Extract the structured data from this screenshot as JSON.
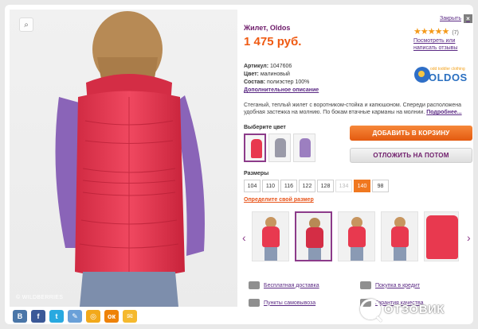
{
  "product": {
    "title": "Жилет, Oldos",
    "price": "1 475 руб.",
    "close_label": "Закрыть",
    "close_icon": "×",
    "rating_stars": "★★★★★",
    "rating_count": "(7)",
    "review_link_1": "Посмотреть или",
    "review_link_2": "написать отзывы"
  },
  "attributes": {
    "article_label": "Артикул:",
    "article_value": "1047606",
    "color_label": "Цвет:",
    "color_value": "малиновый",
    "composition_label": "Состав:",
    "composition_value": "полиэстер 100%",
    "more_link": "Дополнительное описание"
  },
  "brand": {
    "logo": "OLDOS",
    "tagline": "odd toddler clothing"
  },
  "description": {
    "text": "Стеганый, теплый жилет с воротником-стойка и капюшоном. Спереди расположена удобная застежка на молнию. По бокам втачные карманы на молнии.",
    "more": "Подробнее..."
  },
  "colors": {
    "label": "Выберите цвет",
    "swatches": [
      {
        "color": "#e8394f",
        "selected": true
      },
      {
        "color": "#9a9aa8",
        "selected": false
      },
      {
        "color": "#9c7fc0",
        "selected": false
      }
    ]
  },
  "actions": {
    "add_to_cart": "ДОБАВИТЬ В КОРЗИНУ",
    "save_later": "ОТЛОЖИТЬ НА ПОТОМ"
  },
  "sizes": {
    "label": "Размеры",
    "items": [
      {
        "v": "104",
        "state": "normal"
      },
      {
        "v": "110",
        "state": "normal"
      },
      {
        "v": "116",
        "state": "normal"
      },
      {
        "v": "122",
        "state": "normal"
      },
      {
        "v": "128",
        "state": "normal"
      },
      {
        "v": "134",
        "state": "disabled"
      },
      {
        "v": "140",
        "state": "selected"
      },
      {
        "v": "98",
        "state": "normal"
      }
    ],
    "size_link": "Определите свой размер"
  },
  "thumbnails": {
    "count": 5,
    "selected_index": 1
  },
  "perks": {
    "delivery": "Бесплатная доставка",
    "credit": "Покупка в кредит",
    "pickup": "Пункты самовывоза",
    "quality": "Гарантия качества"
  },
  "image": {
    "watermark": "© WILDBERRIES"
  },
  "social": [
    "В",
    "f",
    "t",
    "✎",
    "◎",
    "ок",
    "✉"
  ],
  "site_badge": "ОТЗОВИК",
  "colors_theme": {
    "accent_orange": "#ef5a12",
    "accent_purple": "#6e1b6a",
    "vest_red": "#e8394f"
  }
}
